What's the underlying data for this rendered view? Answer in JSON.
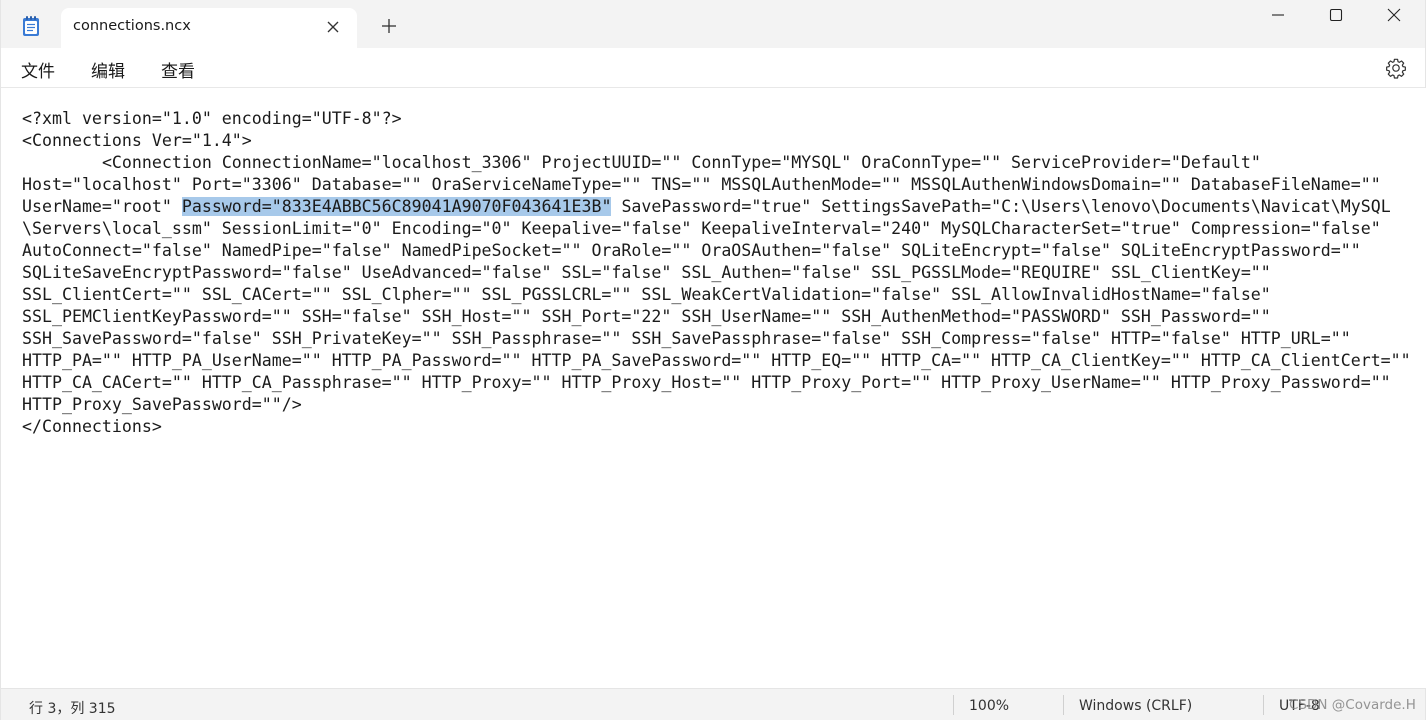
{
  "window": {
    "tab_title": "connections.ncx"
  },
  "icons": {
    "app": "notepad-icon",
    "close_tab": "close-icon",
    "new_tab": "plus-icon",
    "minimize": "minimize-icon",
    "maximize": "maximize-icon",
    "close_window": "close-icon",
    "settings": "gear-icon"
  },
  "menu": {
    "file": "文件",
    "edit": "编辑",
    "view": "查看"
  },
  "editor": {
    "lines": [
      {
        "text": "<?xml version=\"1.0\" encoding=\"UTF-8\"?>"
      },
      {
        "text": "<Connections Ver=\"1.4\">"
      },
      {
        "text": "\t<Connection ConnectionName=\"localhost_3306\" ProjectUUID=\"\" ConnType=\"MYSQL\" OraConnType=\"\" ServiceProvider=\"Default\""
      },
      {
        "text": "Host=\"localhost\" Port=\"3306\" Database=\"\" OraServiceNameType=\"\" TNS=\"\" MSSQLAuthenMode=\"\" MSSQLAuthenWindowsDomain=\"\" DatabaseFileName=\"\""
      },
      {
        "pre": "UserName=\"root\" ",
        "selected": "Password=\"833E4ABBC56C89041A9070F043641E3B\"",
        "post": " SavePassword=\"true\" SettingsSavePath=\"C:\\Users\\lenovo\\Documents\\Navicat\\MySQL"
      },
      {
        "text": "\\Servers\\local_ssm\" SessionLimit=\"0\" Encoding=\"0\" Keepalive=\"false\" KeepaliveInterval=\"240\" MySQLCharacterSet=\"true\" Compression=\"false\""
      },
      {
        "text": "AutoConnect=\"false\" NamedPipe=\"false\" NamedPipeSocket=\"\" OraRole=\"\" OraOSAuthen=\"false\" SQLiteEncrypt=\"false\" SQLiteEncryptPassword=\"\""
      },
      {
        "text": "SQLiteSaveEncryptPassword=\"false\" UseAdvanced=\"false\" SSL=\"false\" SSL_Authen=\"false\" SSL_PGSSLMode=\"REQUIRE\" SSL_ClientKey=\"\""
      },
      {
        "text": "SSL_ClientCert=\"\" SSL_CACert=\"\" SSL_Clpher=\"\" SSL_PGSSLCRL=\"\" SSL_WeakCertValidation=\"false\" SSL_AllowInvalidHostName=\"false\""
      },
      {
        "text": "SSL_PEMClientKeyPassword=\"\" SSH=\"false\" SSH_Host=\"\" SSH_Port=\"22\" SSH_UserName=\"\" SSH_AuthenMethod=\"PASSWORD\" SSH_Password=\"\""
      },
      {
        "text": "SSH_SavePassword=\"false\" SSH_PrivateKey=\"\" SSH_Passphrase=\"\" SSH_SavePassphrase=\"false\" SSH_Compress=\"false\" HTTP=\"false\" HTTP_URL=\"\""
      },
      {
        "text": "HTTP_PA=\"\" HTTP_PA_UserName=\"\" HTTP_PA_Password=\"\" HTTP_PA_SavePassword=\"\" HTTP_EQ=\"\" HTTP_CA=\"\" HTTP_CA_ClientKey=\"\" HTTP_CA_ClientCert=\"\""
      },
      {
        "text": "HTTP_CA_CACert=\"\" HTTP_CA_Passphrase=\"\" HTTP_Proxy=\"\" HTTP_Proxy_Host=\"\" HTTP_Proxy_Port=\"\" HTTP_Proxy_UserName=\"\" HTTP_Proxy_Password=\"\""
      },
      {
        "text": "HTTP_Proxy_SavePassword=\"\"/>"
      },
      {
        "text": "</Connections>"
      }
    ]
  },
  "status": {
    "position": "行 3，列 315",
    "zoom": "100%",
    "line_ending": "Windows (CRLF)",
    "encoding": "UTF-8",
    "watermark": "CSDN @Covarde.H"
  },
  "colors": {
    "titlebar_bg": "#f3f3f3",
    "selection": "#a7c9ea",
    "text": "#1b1b1b"
  }
}
